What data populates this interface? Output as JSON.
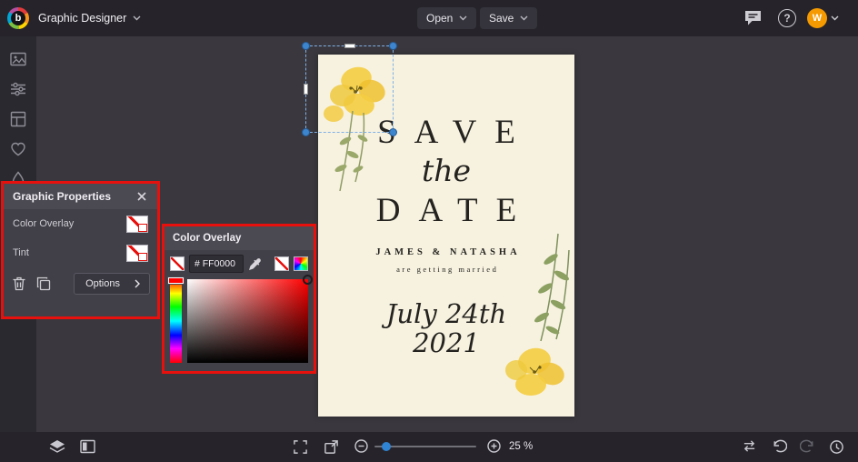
{
  "topbar": {
    "app_menu": "Graphic Designer",
    "open": "Open",
    "save": "Save",
    "avatar": "W"
  },
  "icons": {
    "logo": "b",
    "help": "?"
  },
  "panel": {
    "title": "Graphic Properties",
    "row1": "Color Overlay",
    "row2": "Tint",
    "options": "Options"
  },
  "popup": {
    "title": "Color Overlay",
    "hex": "# FF0000"
  },
  "card": {
    "save": "SAVE",
    "the": "the",
    "date": "DATE",
    "names": "JAMES & NATASHA",
    "tagline": "are getting married",
    "month": "July 24th",
    "year": "2021"
  },
  "bottombar": {
    "zoom": "25 %"
  },
  "colors": {
    "annotation_red": "#e8100c",
    "selection_blue": "#3d85cc",
    "avatar_orange": "#f59a00",
    "card_cream": "#f7f2e0",
    "overlay_color": "#FF0000"
  }
}
